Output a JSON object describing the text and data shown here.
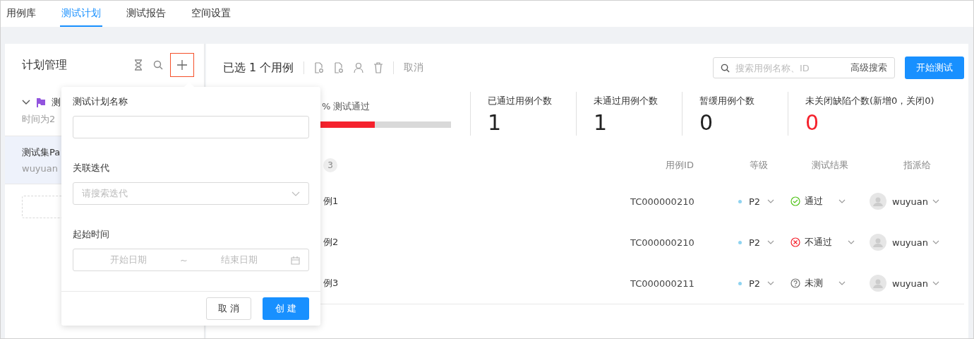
{
  "tabs": [
    {
      "label": "用例库",
      "selected": false
    },
    {
      "label": "测试计划",
      "selected": true
    },
    {
      "label": "测试报告",
      "selected": false
    },
    {
      "label": "空间设置",
      "selected": false
    }
  ],
  "sidebar": {
    "title": "计划管理",
    "items": [
      {
        "label": "测",
        "meta": "时间为2",
        "expanded": true,
        "selected": false,
        "color": "#9254de"
      },
      {
        "label": "测试集Pa",
        "meta": "wuyuan",
        "selected": true
      }
    ]
  },
  "toolbar": {
    "selection": "已选 1 个用例",
    "cancel": "取消",
    "search_placeholder": "搜索用例名称、ID",
    "advanced_search": "高级搜索",
    "start_button": "开始测试"
  },
  "stats": {
    "progress_label": "% 测试通过",
    "level": 0.45,
    "cards": [
      {
        "label": "已通过用例个数",
        "value": "1",
        "alert": false
      },
      {
        "label": "未通过用例个数",
        "value": "1",
        "alert": false
      },
      {
        "label": "暂缓用例个数",
        "value": "0",
        "alert": false
      },
      {
        "label": "未关闭缺陷个数(新增0，关闭0)",
        "value": "0",
        "alert": true
      }
    ]
  },
  "table": {
    "count": "3",
    "columns": [
      "用例ID",
      "等级",
      "测试结果",
      "指派给"
    ],
    "rows": [
      {
        "name": "例1",
        "id": "TC000000210",
        "priority": "P2",
        "color": "#8fd3f0",
        "result": "通过",
        "kind": "pass",
        "assignee": "wuyuan"
      },
      {
        "name": "例2",
        "id": "TC000000210",
        "priority": "P2",
        "color": "#8fd3f0",
        "result": "不通过",
        "kind": "fail",
        "assignee": "wuyuan"
      },
      {
        "name": "例3",
        "id": "TC000000211",
        "priority": "P2",
        "color": "#8fd3f0",
        "result": "未测",
        "kind": "untested",
        "assignee": "wuyuan"
      }
    ]
  },
  "popover": {
    "name_label": "测试计划名称",
    "iteration_label": "关联迭代",
    "iteration_placeholder": "请搜索迭代",
    "time_label": "起始时间",
    "start_placeholder": "开始日期",
    "separator": "~",
    "end_placeholder": "结束日期",
    "cancel": "取 消",
    "create": "创 建"
  }
}
